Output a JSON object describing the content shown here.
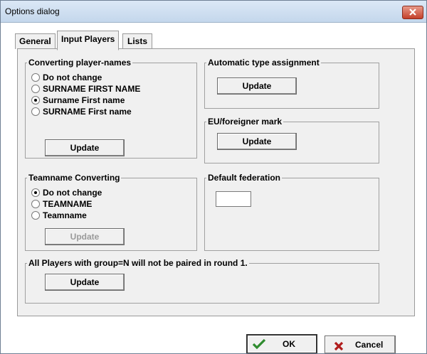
{
  "window": {
    "title": "Options dialog"
  },
  "tabs": [
    {
      "label": "General"
    },
    {
      "label": "Input Players"
    },
    {
      "label": "Lists"
    }
  ],
  "converting_names": {
    "legend": "Converting player-names",
    "options": [
      "Do not change",
      "SURNAME FIRST NAME",
      "Surname First name",
      "SURNAME First name"
    ],
    "selected": "Surname First name",
    "update_label": "Update"
  },
  "auto_type": {
    "legend": "Automatic type assignment",
    "update_label": "Update"
  },
  "eu_mark": {
    "legend": "EU/foreigner mark",
    "update_label": "Update"
  },
  "teamname": {
    "legend": "Teamname Converting",
    "options": [
      "Do not change",
      "TEAMNAME",
      "Teamname"
    ],
    "selected": "Do not change",
    "update_label": "Update",
    "update_enabled": false
  },
  "default_federation": {
    "legend": "Default federation",
    "value": ""
  },
  "group_n": {
    "legend": "All Players with group=N will not be paired in round 1.",
    "update_label": "Update"
  },
  "footer": {
    "ok_label": "OK",
    "cancel_label": "Cancel"
  },
  "colors": {
    "ok_check": "#2e8b2e",
    "cancel_x": "#b01c1c",
    "close_button": "#c4402a"
  }
}
